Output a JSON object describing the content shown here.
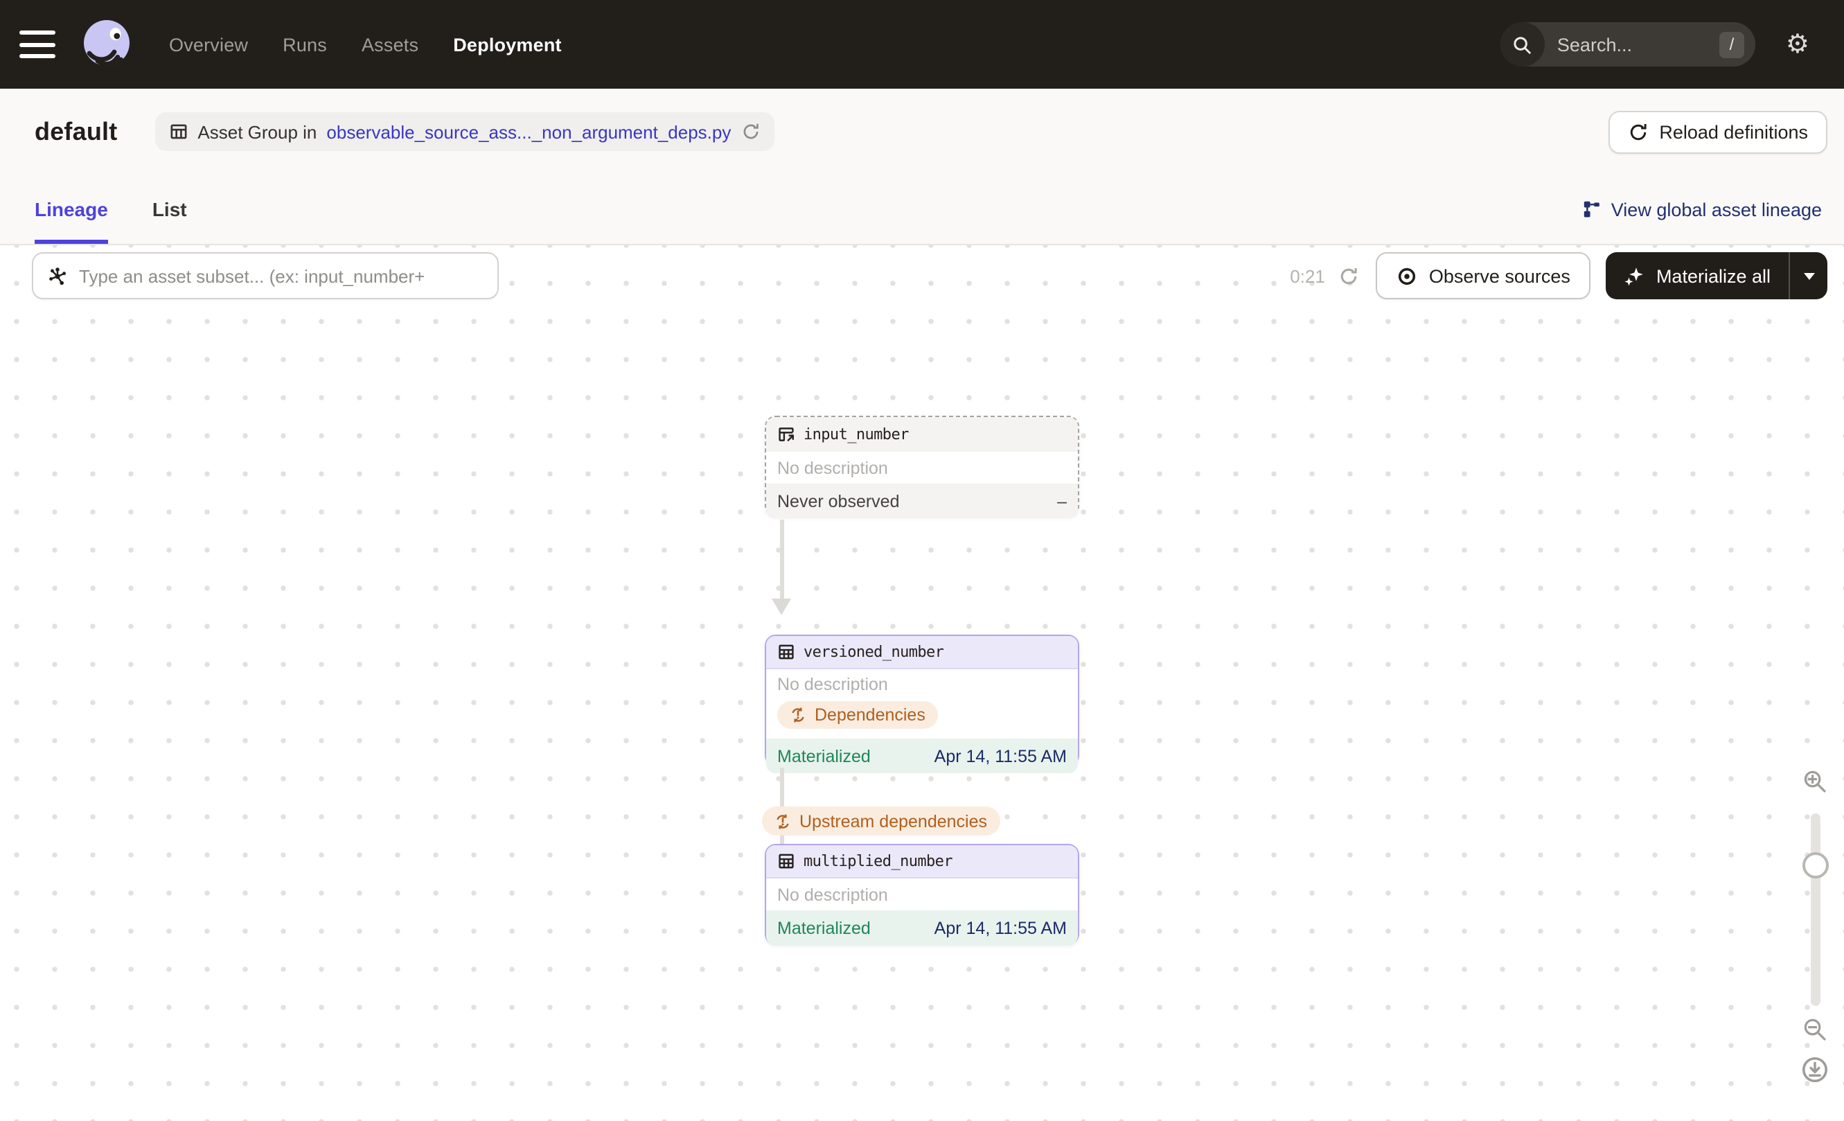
{
  "topbar": {
    "nav_items": [
      {
        "label": "Overview"
      },
      {
        "label": "Runs"
      },
      {
        "label": "Assets"
      },
      {
        "label": "Deployment"
      }
    ],
    "search": {
      "placeholder": "Search...",
      "shortcut": "/"
    }
  },
  "header": {
    "title": "default",
    "asset_group_label": "Asset Group in",
    "asset_group_link": "observable_source_ass..._non_argument_deps.py",
    "reload_button": "Reload definitions"
  },
  "tabs": {
    "lineage": "Lineage",
    "list": "List",
    "global_lineage_link": "View global asset lineage"
  },
  "toolbar": {
    "subset_placeholder": "Type an asset subset... (ex: input_number+",
    "timer": "0:21",
    "observe_button": "Observe sources",
    "materialize_button": "Materialize all"
  },
  "graph": {
    "edge_label": "Upstream dependencies",
    "nodes": [
      {
        "name": "input_number",
        "description": "No description",
        "status": "Never observed",
        "status_value": "–"
      },
      {
        "name": "versioned_number",
        "description": "No description",
        "badge": "Dependencies",
        "status": "Materialized",
        "status_value": "Apr 14, 11:55 AM"
      },
      {
        "name": "multiplied_number",
        "description": "No description",
        "status": "Materialized",
        "status_value": "Apr 14, 11:55 AM"
      }
    ]
  },
  "colors": {
    "topbar_bg": "#221F1B",
    "accent": "#4E42DE",
    "header_link": "#3936C5",
    "navy_link": "#22306E",
    "warning_fg": "#B05F1E",
    "warning_bg": "#FAEDE0",
    "success_fg": "#1E8757",
    "success_bg": "#E9F3EE",
    "node_border_purple": "#B3A6EC",
    "node_border_dashed": "#A5A39F"
  }
}
